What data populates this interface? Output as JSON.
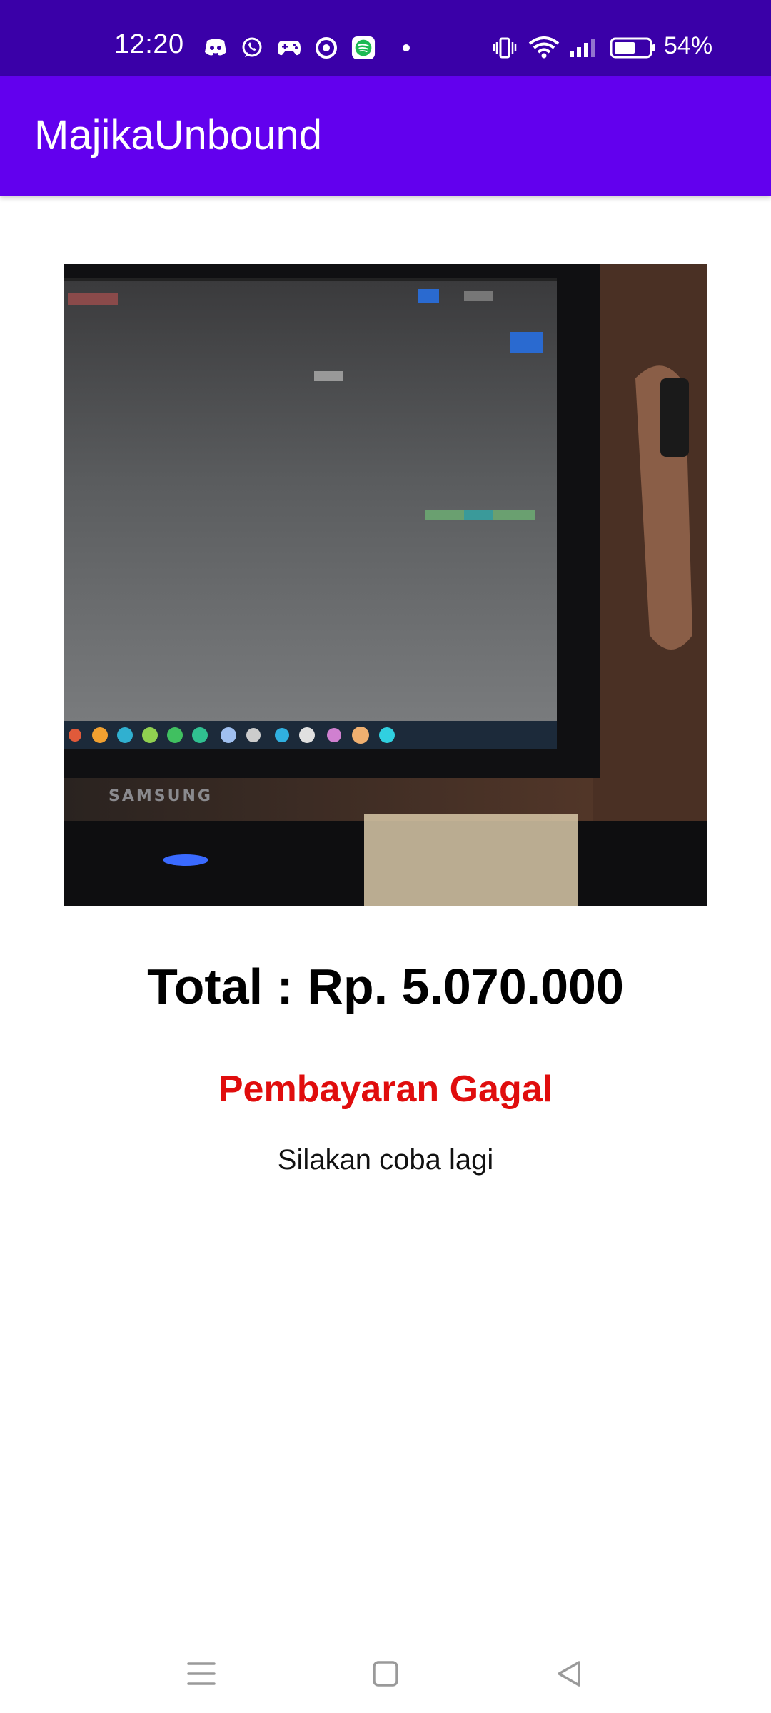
{
  "status_bar": {
    "time": "12:20",
    "battery_percent": "54%",
    "notification_icons": [
      "discord-icon",
      "whatsapp-icon",
      "gamepad-icon",
      "podcast-icon",
      "spotify-icon",
      "more-dot-icon"
    ],
    "system_icons": [
      "vibrate-icon",
      "wifi-icon",
      "signal-icon",
      "battery-icon"
    ]
  },
  "app_bar": {
    "title": "MajikaUnbound"
  },
  "main": {
    "photo_icon": "product-photo-monitor",
    "monitor_brand": "SAMSUNG",
    "total_text": "Total : Rp. 5.070.000",
    "payment_status": "Pembayaran Gagal",
    "retry_message": "Silakan coba lagi"
  },
  "nav_bar": {
    "buttons": [
      "menu-icon",
      "home-icon",
      "back-icon"
    ]
  },
  "colors": {
    "status_bar": "#3a00a8",
    "app_bar": "#6200ee",
    "failed_text": "#e00d0d",
    "background": "#ffffff"
  }
}
